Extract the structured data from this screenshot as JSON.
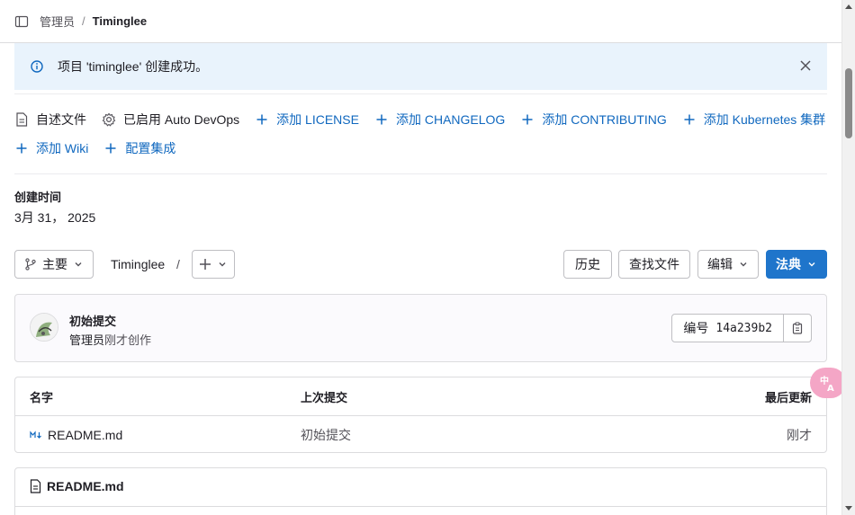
{
  "breadcrumb": {
    "group": "管理员",
    "separator": "/",
    "project": "Timinglee"
  },
  "alert": {
    "message": "项目 'timinglee' 创建成功。"
  },
  "quick_links": {
    "row1": [
      {
        "label": "自述文件",
        "icon": "file-icon",
        "style": "plain"
      },
      {
        "label": "已启用 Auto DevOps",
        "icon": "gear-icon",
        "style": "plain"
      },
      {
        "label": "添加 LICENSE",
        "icon": "plus-icon",
        "style": "blue"
      },
      {
        "label": "添加 CHANGELOG",
        "icon": "plus-icon",
        "style": "blue"
      },
      {
        "label": "添加 CONTRIBUTING",
        "icon": "plus-icon",
        "style": "blue"
      },
      {
        "label": "添加 Kubernetes 集群",
        "icon": "plus-icon",
        "style": "blue"
      }
    ],
    "row2": [
      {
        "label": "添加 Wiki",
        "icon": "plus-icon",
        "style": "blue"
      },
      {
        "label": "配置集成",
        "icon": "plus-icon",
        "style": "blue"
      }
    ]
  },
  "created": {
    "label": "创建时间",
    "date": "3月 31， 2025"
  },
  "toolbar": {
    "branch_label": "主要",
    "path_root": "Timinglee",
    "path_sep": "/",
    "history_label": "历史",
    "find_file_label": "查找文件",
    "edit_label": "编辑",
    "code_label": "法典"
  },
  "commit": {
    "title": "初始提交",
    "author": "管理员",
    "time_text": "刚才创作",
    "sha_label": "编号",
    "sha": "14a239b2"
  },
  "files_table": {
    "headers": {
      "name": "名字",
      "last_commit": "上次提交",
      "last_update": "最后更新"
    },
    "rows": [
      {
        "name": "README.md",
        "last_commit": "初始提交",
        "last_update": "刚才"
      }
    ]
  },
  "readme": {
    "title": "README.md"
  },
  "colors": {
    "primary": "#1f75cb",
    "link": "#1068bf",
    "alert_bg": "#e9f3fc"
  }
}
